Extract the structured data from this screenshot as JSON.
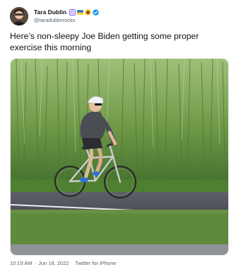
{
  "tweet": {
    "author": {
      "display_name": "Tara Dublin",
      "handle": "@taradublinrocks",
      "avatar_icon": "user-avatar-photo",
      "name_emojis": [
        "purple-badge-icon",
        "ukraine-flag-icon",
        "sunflower-icon"
      ],
      "verified_icon": "verified-badge-icon",
      "verified_color": "#1d9bf0"
    },
    "text": "Here’s non-sleepy Joe Biden getting some proper exercise this morning",
    "media": {
      "kind": "photo",
      "icon": "photo-man-riding-bicycle"
    },
    "meta": {
      "time": "10:19 AM",
      "separator1": "·",
      "date": "Jun 18, 2022",
      "separator2": "·",
      "source": "Twitter for iPhone"
    }
  },
  "colors": {
    "text_primary": "#0f1419",
    "text_secondary": "#536471",
    "accent": "#1d9bf0"
  }
}
